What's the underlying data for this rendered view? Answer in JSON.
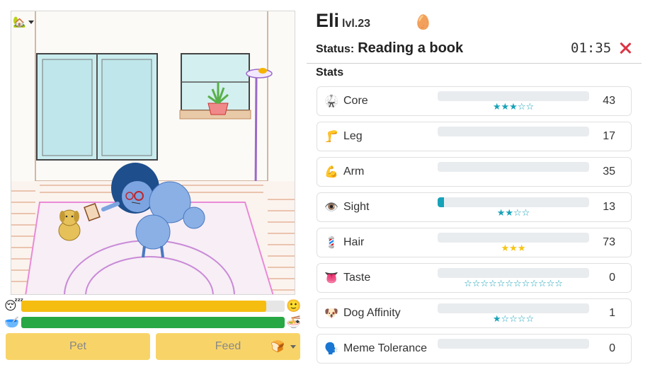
{
  "scene": {
    "home_icon": "house-icon"
  },
  "meters": {
    "energy": {
      "left_icon": "sleepy-face-icon",
      "left_emoji": "😴",
      "right_icon": "smiley-face-icon",
      "right_emoji": "🙂",
      "level": 0.93,
      "color": "#f6bd11"
    },
    "food": {
      "left_icon": "empty-bowl-icon",
      "left_emoji": "🥣",
      "right_icon": "noodle-bowl-icon",
      "right_emoji": "🍜",
      "level": 1.0,
      "color": "#28a745"
    }
  },
  "actions": {
    "pet_label": "Pet",
    "feed_label": "Feed",
    "feed_item_icon": "bread-icon",
    "feed_item_emoji": "🍞"
  },
  "character": {
    "name": "Eli",
    "level": "lvl.23",
    "egg_emoji": "🥚"
  },
  "status": {
    "label": "Status:",
    "value": "Reading a book",
    "timer": "01:35"
  },
  "stats_title": "Stats",
  "accent_color": "#17a2b8",
  "stats": [
    {
      "icon": "martial-arts-uniform-icon",
      "emoji": "🥋",
      "label": "Core",
      "value": "43",
      "progress": 0.0,
      "stars_on": 3,
      "stars_total": 5,
      "gold": false
    },
    {
      "icon": "leg-icon",
      "emoji": "🦵",
      "label": "Leg",
      "value": "17",
      "progress": 0.0,
      "stars_on": 0,
      "stars_total": 0,
      "gold": false
    },
    {
      "icon": "flexed-biceps-icon",
      "emoji": "💪",
      "label": "Arm",
      "value": "35",
      "progress": 0.0,
      "stars_on": 0,
      "stars_total": 0,
      "gold": false
    },
    {
      "icon": "eye-icon",
      "emoji": "👁️",
      "label": "Sight",
      "value": "13",
      "progress": 0.04,
      "stars_on": 2,
      "stars_total": 4,
      "gold": false
    },
    {
      "icon": "barber-pole-icon",
      "emoji": "💈",
      "label": "Hair",
      "value": "73",
      "progress": 0.0,
      "stars_on": 3,
      "stars_total": 3,
      "gold": true
    },
    {
      "icon": "tongue-icon",
      "emoji": "👅",
      "label": "Taste",
      "value": "0",
      "progress": 0.0,
      "stars_on": 0,
      "stars_total": 12,
      "gold": false
    },
    {
      "icon": "dog-face-icon",
      "emoji": "🐶",
      "label": "Dog Affinity",
      "value": "1",
      "progress": 0.0,
      "stars_on": 1,
      "stars_total": 5,
      "gold": false
    },
    {
      "icon": "speaking-head-icon",
      "emoji": "🗣️",
      "label": "Meme Tolerance",
      "value": "0",
      "progress": 0.0,
      "stars_on": 0,
      "stars_total": 0,
      "gold": false
    }
  ]
}
